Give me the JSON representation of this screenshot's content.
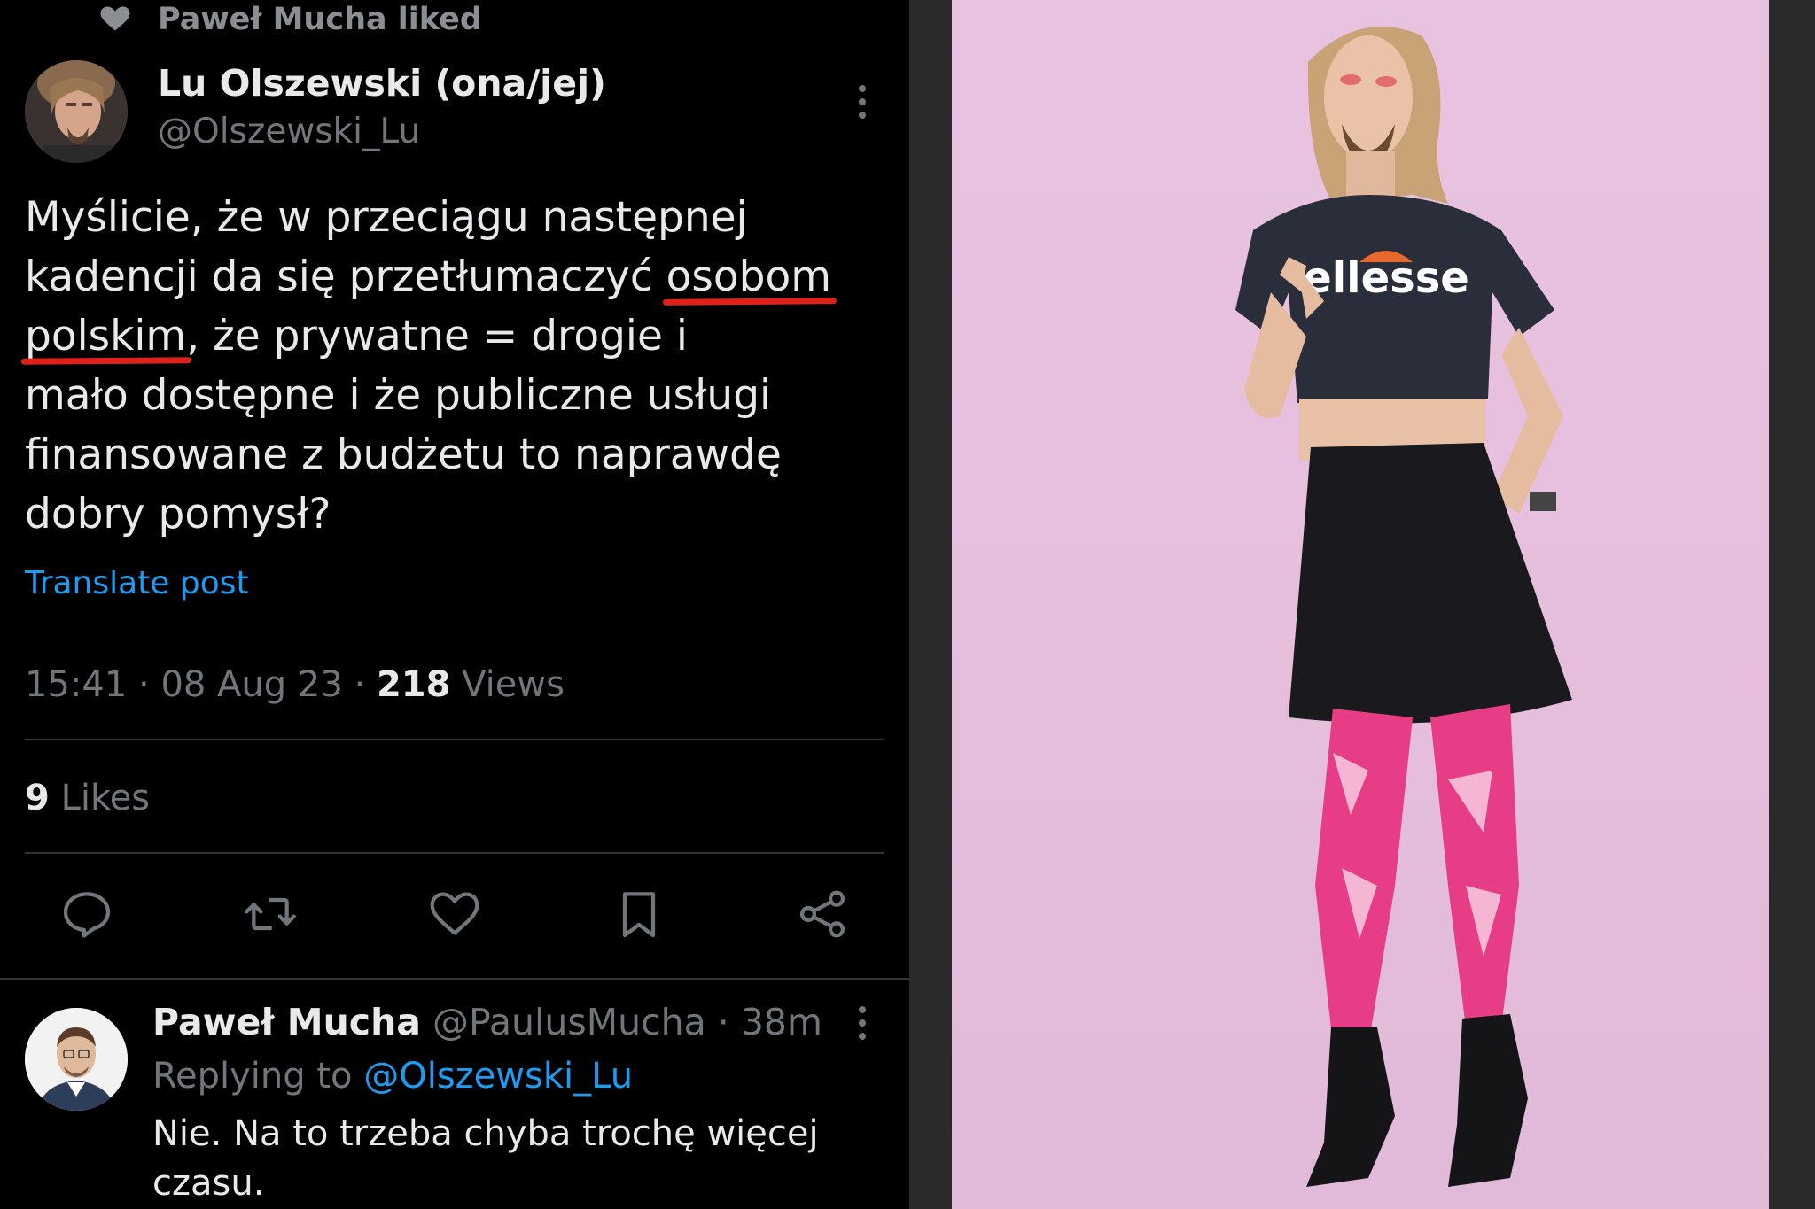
{
  "social_context": {
    "text": "Paweł Mucha liked",
    "icon": "heart-icon"
  },
  "tweet": {
    "author_name": "Lu Olszewski (ona/jej)",
    "author_handle": "@Olszewski_Lu",
    "body_lines": [
      [
        "Myślicie, że w przeciągu następnej",
        "",
        ""
      ],
      [
        "kadencji da się przetłumaczyć ",
        "osobom",
        ""
      ],
      [
        "",
        "polskim",
        ", że prywatne = drogie i"
      ],
      [
        "mało dostępne i że publiczne usługi",
        "",
        ""
      ],
      [
        "finansowane z budżetu to naprawdę",
        "",
        ""
      ],
      [
        "dobry pomysł?",
        "",
        ""
      ]
    ],
    "translate_label": "Translate post",
    "time": "15:41",
    "date": "08 Aug 23",
    "views_count": "218",
    "views_label": "Views",
    "likes_count": "9",
    "likes_label": "Likes",
    "actions": [
      "reply-icon",
      "retweet-icon",
      "like-icon",
      "bookmark-icon",
      "share-icon"
    ],
    "underline_color": "#e0201a"
  },
  "reply": {
    "name": "Paweł Mucha",
    "handle": "@PaulusMucha",
    "time": "38m",
    "replying_prefix": "Replying to",
    "replying_to": "@Olszewski_Lu",
    "text": "Nie. Na to trzeba chyba trochę więcej czasu."
  },
  "photo": {
    "background_color": "#e8c3e0",
    "shirt_text": "ellesse"
  },
  "colors": {
    "background": "#000000",
    "text_primary": "#e7e9ea",
    "text_secondary": "#71767b",
    "link": "#1d9bf0",
    "divider": "#2f3336"
  }
}
